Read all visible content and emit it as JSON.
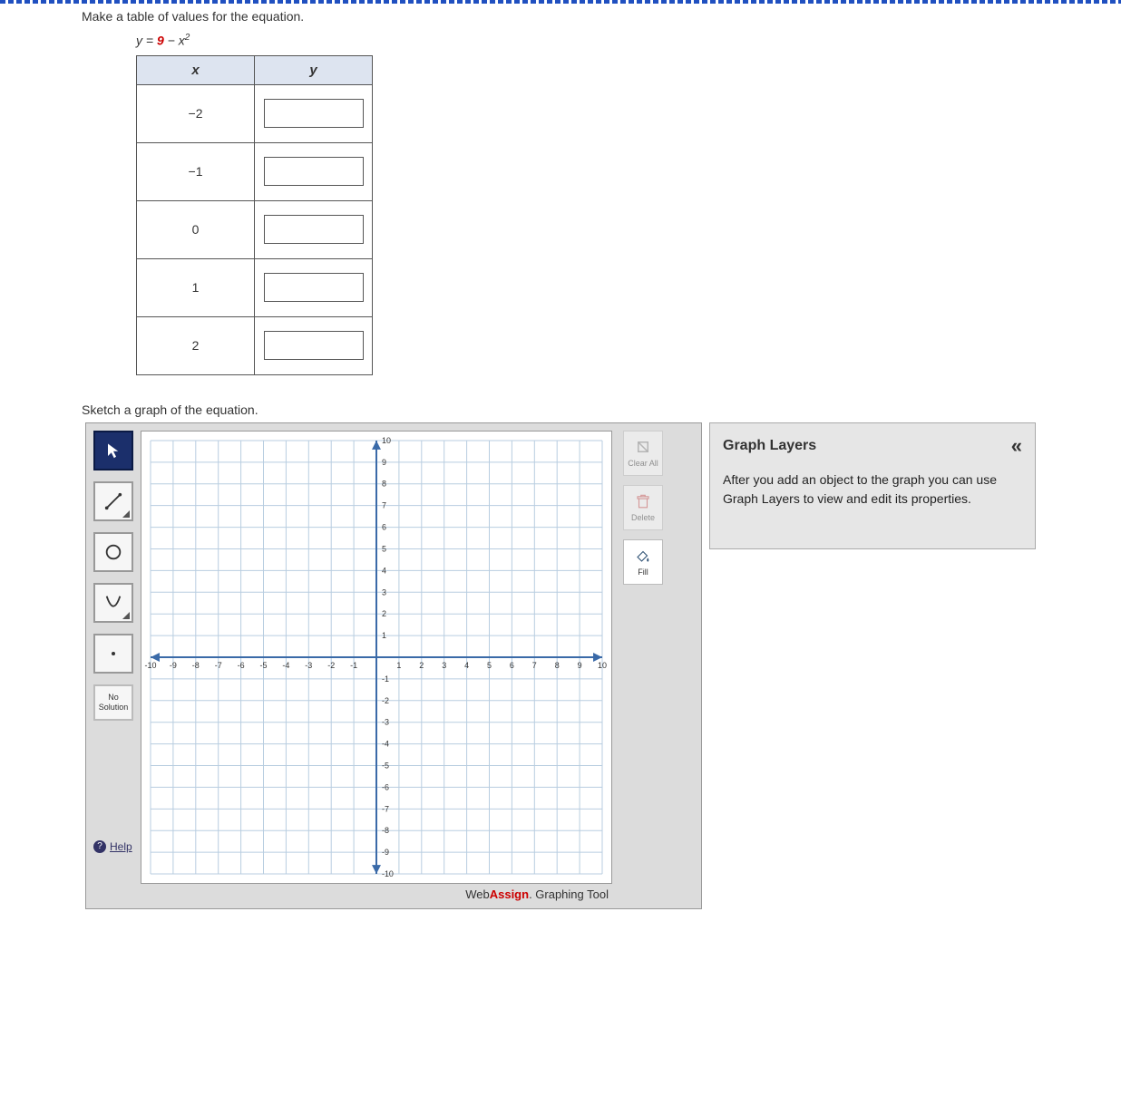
{
  "instruction1": "Make a table of values for the equation.",
  "equation_lhs": "y",
  "equation_eq": " = ",
  "equation_nine": "9",
  "equation_minus": " − ",
  "equation_x": "x",
  "equation_exp": "2",
  "table": {
    "header_x": "x",
    "header_y": "y",
    "rows": [
      {
        "x": "−2",
        "y": ""
      },
      {
        "x": "−1",
        "y": ""
      },
      {
        "x": "0",
        "y": ""
      },
      {
        "x": "1",
        "y": ""
      },
      {
        "x": "2",
        "y": ""
      }
    ]
  },
  "instruction2": "Sketch a graph of the equation.",
  "tools": {
    "no_solution_l1": "No",
    "no_solution_l2": "Solution",
    "help": "Help"
  },
  "actions": {
    "clear_all": "Clear All",
    "delete": "Delete",
    "fill": "Fill"
  },
  "brand": {
    "web": "Web",
    "assign": "Assign",
    "tool": ". Graphing Tool"
  },
  "layers": {
    "title": "Graph Layers",
    "desc": "After you add an object to the graph you can use Graph Layers to view and edit its properties."
  },
  "chart_data": {
    "type": "scatter",
    "title": "",
    "xlabel": "",
    "ylabel": "",
    "xlim": [
      -10,
      10
    ],
    "ylim": [
      -10,
      10
    ],
    "tick_step": 1,
    "series": []
  }
}
